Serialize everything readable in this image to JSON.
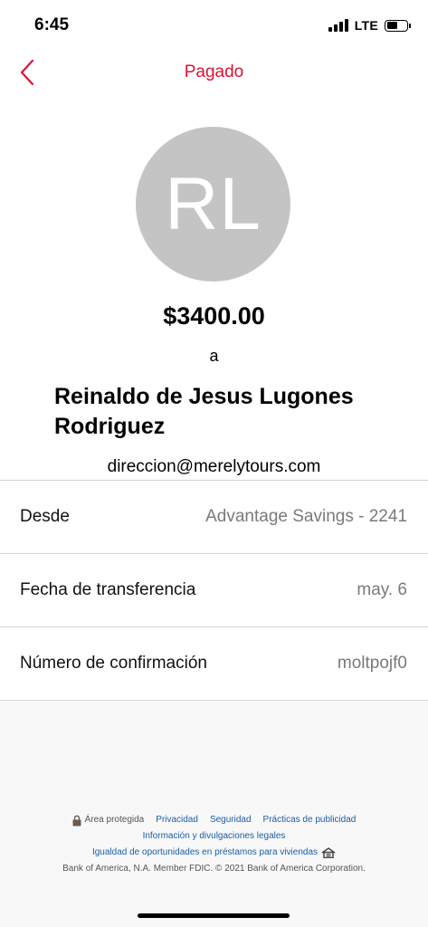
{
  "status_bar": {
    "time": "6:45",
    "network": "LTE"
  },
  "nav": {
    "title": "Pagado",
    "accent_color": "#dc1431",
    "back_icon": "chevron-left-icon"
  },
  "payment": {
    "avatar_initials": "RL",
    "amount": "$3400.00",
    "connector": "a",
    "recipient_name": "Reinaldo de Jesus Lugones Rodriguez",
    "recipient_email": "direccion@merelytours.com"
  },
  "details": [
    {
      "label": "Desde",
      "value": "Advantage Savings - 2241"
    },
    {
      "label": "Fecha de transferencia",
      "value": "may. 6"
    },
    {
      "label": "Número de confirmación",
      "value": "moltpojf0"
    }
  ],
  "footer": {
    "secure_area": "Área protegida",
    "privacy": "Privacidad",
    "security": "Seguridad",
    "advertising": "Prácticas de publicidad",
    "legal": "Información y divulgaciones legales",
    "equal_housing": "Igualdad de oportunidades en préstamos para viviendas",
    "copyright": "Bank of America, N.A. Member FDIC. © 2021 Bank of America Corporation."
  }
}
